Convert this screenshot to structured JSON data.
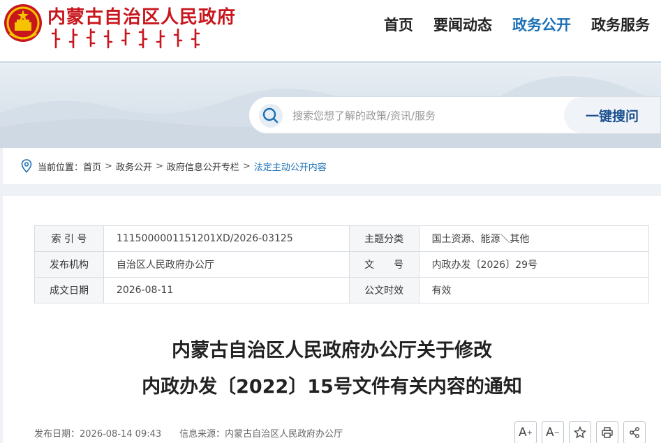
{
  "header": {
    "site_title": "内蒙古自治区人民政府",
    "nav": [
      {
        "label": "首页",
        "active": false
      },
      {
        "label": "要闻动态",
        "active": false
      },
      {
        "label": "政务公开",
        "active": true
      },
      {
        "label": "政务服务",
        "active": false
      }
    ]
  },
  "search": {
    "placeholder": "搜索您想了解的政策/资讯/服务",
    "button_label": "一键搜问"
  },
  "breadcrumb": {
    "prefix": "当前位置：",
    "items": [
      "首页",
      "政务公开",
      "政府信息公开专栏",
      "法定主动公开内容"
    ],
    "separator": ">"
  },
  "meta": {
    "index_label": "索 引 号",
    "index_value": "1115000001151201XD/2026-03125",
    "topic_label": "主题分类",
    "topic_value": "国土资源、能源＼其他",
    "issuer_label": "发布机构",
    "issuer_value": "自治区人民政府办公厅",
    "docno_label": "文　　号",
    "docno_value": "内政办发〔2026〕29号",
    "date_label": "成文日期",
    "date_value": "2026-08-11",
    "validity_label": "公文时效",
    "validity_value": "有效"
  },
  "document": {
    "title_line1": "内蒙古自治区人民政府办公厅关于修改",
    "title_line2": "内政办发〔2022〕15号文件有关内容的通知",
    "publish_date": "发布日期：2026-08-14 09:43",
    "source": "信息来源：内蒙古自治区人民政府办公厅"
  },
  "tools": {
    "font_larger": "A",
    "font_smaller": "A",
    "font_larger_sup": "+",
    "font_smaller_sup": "−"
  },
  "colors": {
    "brand_red": "#c8161d",
    "accent_blue": "#1a6fb5",
    "search_button_text": "#1a4f8f"
  }
}
